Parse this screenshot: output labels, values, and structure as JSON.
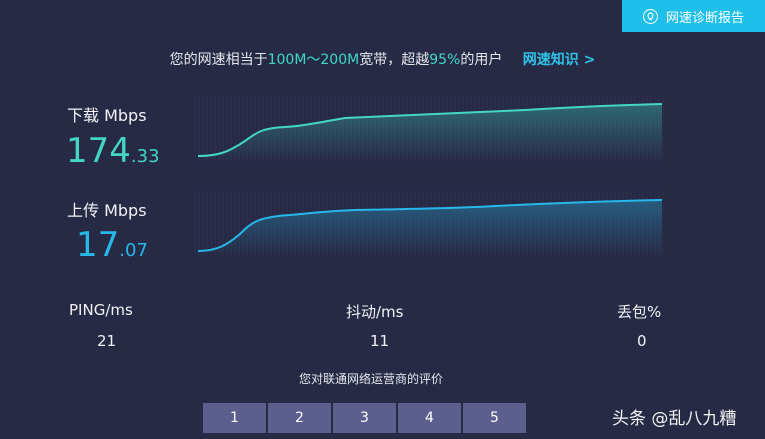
{
  "report_button": {
    "label": "网速诊断报告",
    "icon": "bulb-icon"
  },
  "summary": {
    "prefix": "您的网速相当于",
    "range": "100M～200M",
    "middle": "宽带，超越",
    "percent": "95%",
    "suffix": "的用户",
    "link": "网速知识 >"
  },
  "download": {
    "label": "下载 Mbps",
    "int": "174",
    "dec": ".33",
    "color": "#43d6c5"
  },
  "upload": {
    "label": "上传 Mbps",
    "int": "17",
    "dec": ".07",
    "color": "#27b8ea"
  },
  "stats": {
    "ping": {
      "label": "PING/ms",
      "value": "21"
    },
    "jitter": {
      "label": "抖动/ms",
      "value": "11"
    },
    "loss": {
      "label": "丢包%",
      "value": "0"
    }
  },
  "rating": {
    "title": "您对联通网络运营商的评价",
    "options": [
      "1",
      "2",
      "3",
      "4",
      "5"
    ]
  },
  "watermark": "头条 @乱八九糟"
}
